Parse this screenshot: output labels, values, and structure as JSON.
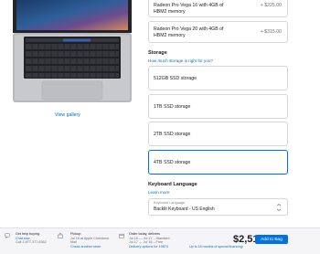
{
  "gallery": {
    "view_gallery_label": "View gallery"
  },
  "graphics": {
    "options": [
      {
        "line1": "Radeon Pro Vega 16 with 4GB of",
        "line2": "HBM2 memory",
        "price": "+ $225.00"
      },
      {
        "line1": "Radeon Pro Vega 20 with 4GB of",
        "line2": "HBM2 memory",
        "price": "+ $315.00"
      }
    ]
  },
  "storage": {
    "heading": "Storage",
    "help_link": "How much storage is right for you?",
    "options": [
      {
        "label": "512GB SSD storage"
      },
      {
        "label": "1TB SSD storage"
      },
      {
        "label": "2TB SSD storage"
      },
      {
        "label": "4TB SSD storage",
        "selected": true
      }
    ]
  },
  "keyboard": {
    "heading": "Keyboard Language",
    "learn_more": "Learn more",
    "select_label": "Keyboard Language",
    "select_value": "Backlit Keyboard - US English"
  },
  "footer": {
    "help": {
      "title": "Get help buying.",
      "chat": "Chat now",
      "phone": "Call 1-877-377-6362"
    },
    "pickup": {
      "title": "Pickup:",
      "line1": "Jul 18 at Apple Christiana",
      "line2": "Mall",
      "link": "Check another store"
    },
    "delivery": {
      "title": "Order today, delivers",
      "line1": "Jul 16 — Jul 17 – Standard",
      "line2": "Jul 17 — Jul 18 – Free",
      "link": "Delivery options for 19874"
    },
    "total": "$2,519.00",
    "financing": "Up to 18 months of special financing›",
    "add_to_bag": "Add to Bag"
  },
  "colors": {
    "accent": "#0071e3",
    "link": "#0070c9",
    "footer_bg": "#f5f5f7"
  },
  "icons": [
    "chat-icon",
    "store-icon",
    "box-icon",
    "chevron-down-icon"
  ]
}
